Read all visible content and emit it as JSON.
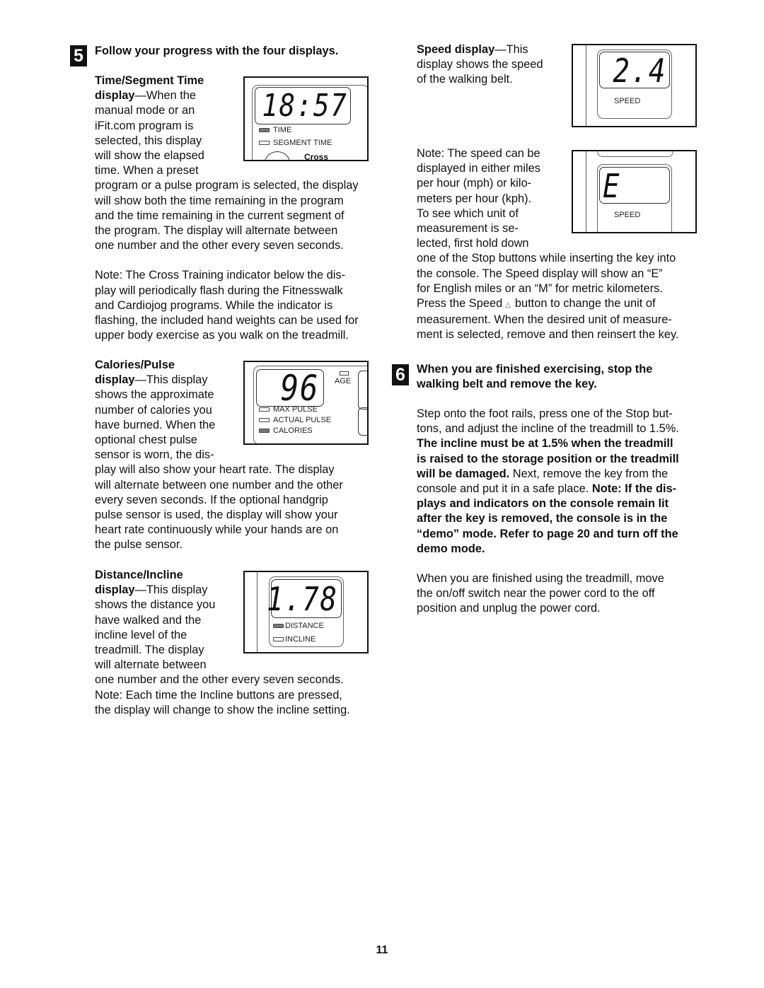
{
  "page_number": "11",
  "step5": {
    "number": "5",
    "heading": "Follow your progress with the four displays.",
    "time_display": {
      "title": "Time/Segment Time",
      "title2": "display",
      "dash": "—",
      "lines_narrow": [
        "When the",
        "manual mode or an",
        "iFit.com program is",
        "selected, this display",
        "will show the elapsed",
        "time. When a preset"
      ],
      "lines_wide": [
        "program or a pulse program is selected, the display",
        "will show both the time remaining in the program",
        "and the time remaining in the current segment of",
        "the program. The display will alternate between",
        "one number and the other every seven seconds."
      ],
      "note_lines": [
        "Note: The Cross Training indicator below the dis-",
        "play will periodically flash during the Fitnesswalk",
        "and Cardiojog programs. While the indicator is",
        "flashing, the included hand weights can be used for",
        "upper body exercise as you walk on the treadmill."
      ],
      "lcd": {
        "value": "18:57",
        "indicators": [
          {
            "label": "TIME",
            "on": true
          },
          {
            "label": "SEGMENT TIME",
            "on": false
          }
        ],
        "cross_label": "Cross"
      }
    },
    "calories_display": {
      "title": "Calories/Pulse",
      "title2": "display",
      "dash": "—",
      "lines_narrow": [
        "This display",
        "shows the approximate",
        "number of calories you",
        "have burned. When the",
        "optional chest pulse",
        "sensor is worn, the dis-"
      ],
      "lines_wide": [
        "play will also show your heart rate. The display",
        "will alternate between one number and the other",
        "every seven seconds. If the optional handgrip",
        "pulse sensor is used, the display will show your",
        "heart rate continuously while your hands are on",
        "the pulse sensor."
      ],
      "lcd": {
        "value": "96",
        "age_label": "AGE",
        "indicators": [
          {
            "label": "MAX PULSE",
            "on": false
          },
          {
            "label": "ACTUAL PULSE",
            "on": false
          },
          {
            "label": "CALORIES",
            "on": true
          }
        ]
      }
    },
    "distance_display": {
      "title": "Distance/Incline",
      "title2": "display",
      "dash": "—",
      "lines_narrow": [
        "This display",
        "shows the distance you",
        "have walked and the",
        "incline level of the",
        "treadmill. The display",
        "will alternate between"
      ],
      "lines_wide": [
        "one number and the other every seven seconds.",
        "Note: Each time the Incline buttons are pressed,",
        "the display will change to show the incline setting."
      ],
      "lcd": {
        "value": "1.78",
        "indicators": [
          {
            "label": "DISTANCE",
            "on": true
          },
          {
            "label": "INCLINE",
            "on": false
          }
        ]
      }
    },
    "speed_display": {
      "title": "Speed display",
      "dash": "—",
      "lines": [
        "This",
        "display shows the speed",
        "of the walking belt."
      ],
      "lcd": {
        "value": "2.4",
        "label": "SPEED"
      },
      "note_lines_narrow": [
        "Note: The speed can be",
        "displayed in either miles",
        "per hour (mph) or kilo-",
        "meters per hour (kph).",
        "To see which unit of",
        "measurement is se-",
        "lected, first hold down"
      ],
      "note_lines_wide": [
        "one of the Stop buttons while inserting the key into",
        "the console. The Speed display will show an “E”",
        "for English miles or an “M” for metric kilometers."
      ],
      "press_before": "Press the Speed",
      "speed_icon": "speed-button-icon",
      "press_after": "button to change the unit of",
      "note_lines_end": [
        "measurement. When the desired unit of measure-",
        "ment is selected, remove and then reinsert the key."
      ],
      "unit_lcd": {
        "value": "E",
        "label": "SPEED"
      }
    }
  },
  "step6": {
    "number": "6",
    "heading_lines": [
      "When you are finished exercising, stop the",
      "walking belt and remove the key."
    ],
    "p1_lines": [
      "Step onto the foot rails, press one of the Stop but-",
      "tons, and adjust the incline of the treadmill to 1.5%."
    ],
    "p1_bold_lines": [
      "The incline must be at 1.5% when the treadmill",
      "is raised to the storage position or the treadmill"
    ],
    "p1_bold_tail": "will be damaged.",
    "p1_tail": " Next, remove the key from the",
    "p1_line_console": "console and put it in a safe place. ",
    "p1_note_start": "Note: If the dis-",
    "p1_note_lines": [
      "plays and indicators on the console remain lit",
      "after the key is removed, the console is in the",
      "“demo” mode. Refer to page 20 and turn off the",
      "demo mode."
    ],
    "p2_lines": [
      "When you are finished using the treadmill, move",
      "the on/off switch near the power cord to the off",
      "position and unplug the power cord."
    ]
  }
}
